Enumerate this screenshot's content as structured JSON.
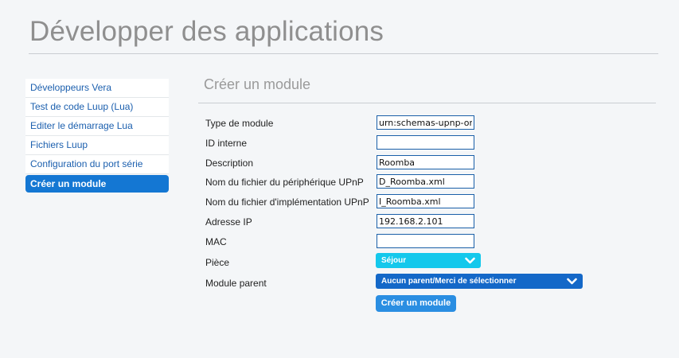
{
  "header": {
    "title": "Développer des applications"
  },
  "sidebar": {
    "items": [
      {
        "label": "Développeurs Vera"
      },
      {
        "label": "Test de code Luup (Lua)"
      },
      {
        "label": "Editer le démarrage Lua"
      },
      {
        "label": "Fichiers Luup"
      },
      {
        "label": "Configuration du port série"
      },
      {
        "label": "Créer un module"
      }
    ],
    "active_index": 5
  },
  "main": {
    "title": "Créer un module",
    "fields": {
      "type_module": {
        "label": "Type de module",
        "value": "urn:schemas-upnp-or"
      },
      "id_interne": {
        "label": "ID interne",
        "value": ""
      },
      "description": {
        "label": "Description",
        "value": "Roomba"
      },
      "fichier_peripherique": {
        "label": "Nom du fichier du périphérique UPnP",
        "value": "D_Roomba.xml"
      },
      "fichier_implementation": {
        "label": "Nom du fichier d'implémentation UPnP",
        "value": "I_Roomba.xml"
      },
      "adresse_ip": {
        "label": "Adresse IP",
        "value": "192.168.2.101"
      },
      "mac": {
        "label": "MAC",
        "value": ""
      },
      "piece": {
        "label": "Pièce",
        "selected": "Séjour"
      },
      "module_parent": {
        "label": "Module parent",
        "selected": "Aucun parent/Merci de sélectionner"
      }
    },
    "submit_label": "Créer un module"
  },
  "colors": {
    "accent": "#1477d3",
    "piece_select": "#14c8ec",
    "parent_select": "#1468c8",
    "button": "#2a8ee2",
    "link": "#1b5fae"
  }
}
